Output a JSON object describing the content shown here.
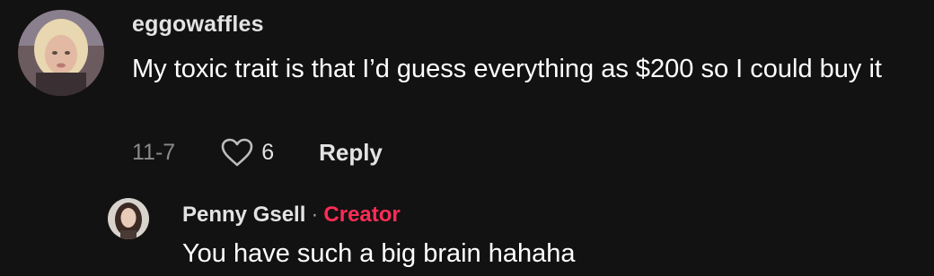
{
  "comment": {
    "avatar_icon": "user-avatar-photo",
    "username": "eggowaffles",
    "text": "My toxic trait is that I’d guess everything as $200 so I could buy it",
    "date": "11-7",
    "like_icon": "heart-outline-icon",
    "like_count": "6",
    "reply_label": "Reply"
  },
  "reply": {
    "avatar_icon": "creator-avatar-photo",
    "username": "Penny Gsell",
    "separator": "·",
    "badge": "Creator",
    "text": "You have such a big brain hahaha"
  },
  "colors": {
    "background": "#121212",
    "creator_accent": "#fe2c55",
    "muted_text": "#8a8a8a"
  }
}
